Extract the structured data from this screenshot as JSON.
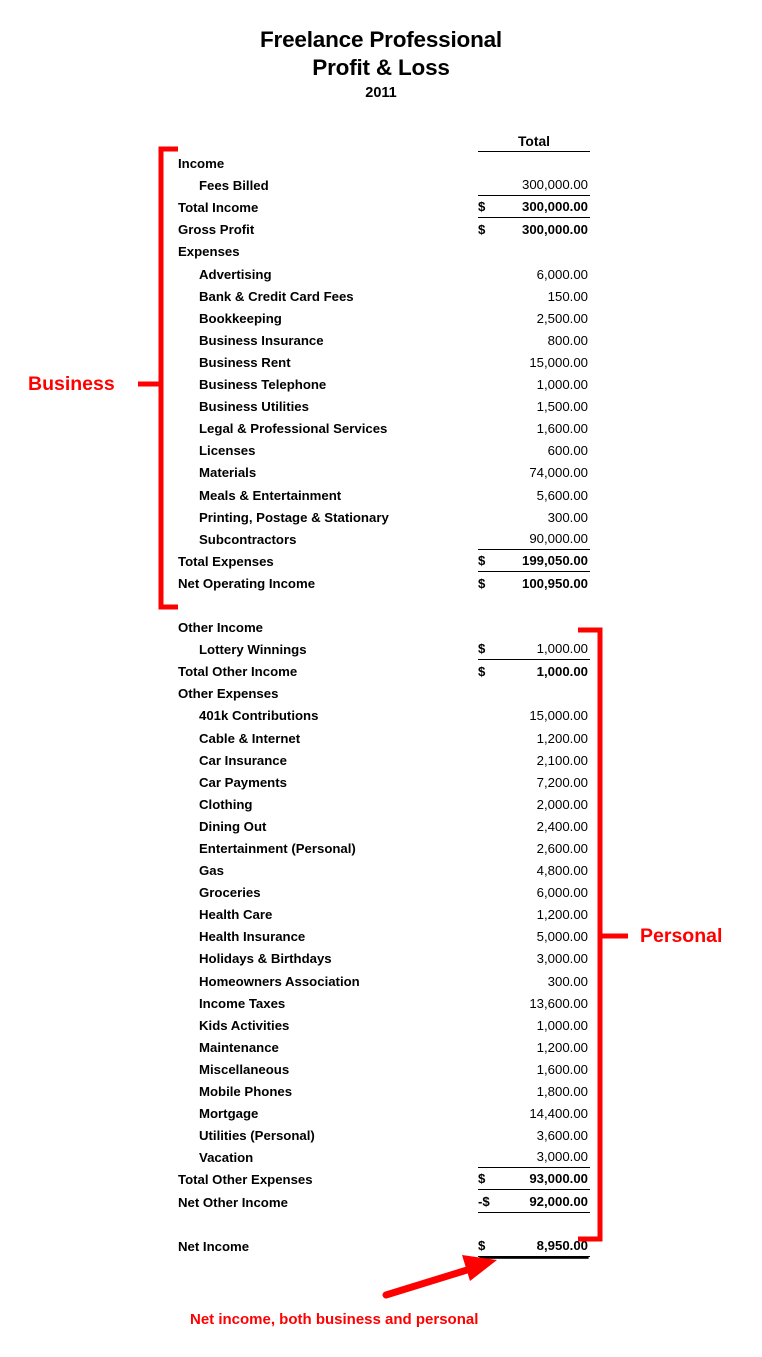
{
  "document": {
    "title_line1": "Freelance Professional",
    "title_line2": "Profit & Loss",
    "year": "2011"
  },
  "table": {
    "column_header": "Total",
    "currency_symbol": "$",
    "negative_currency_symbol": "-$"
  },
  "annotations": {
    "business_label": "Business",
    "personal_label": "Personal",
    "net_income_note": "Net income, both business and personal",
    "color": "#ff0000"
  },
  "rows": {
    "income_heading": "Income",
    "fees_billed": {
      "label": "Fees Billed",
      "amount": "300,000.00"
    },
    "total_income": {
      "label": "Total Income",
      "currency": "$",
      "amount": "300,000.00"
    },
    "gross_profit": {
      "label": "Gross Profit",
      "currency": "$",
      "amount": "300,000.00"
    },
    "expenses_heading": "Expenses",
    "business_expenses": [
      {
        "label": "Advertising",
        "amount": "6,000.00"
      },
      {
        "label": "Bank & Credit Card Fees",
        "amount": "150.00"
      },
      {
        "label": "Bookkeeping",
        "amount": "2,500.00"
      },
      {
        "label": "Business Insurance",
        "amount": "800.00"
      },
      {
        "label": "Business Rent",
        "amount": "15,000.00"
      },
      {
        "label": "Business Telephone",
        "amount": "1,000.00"
      },
      {
        "label": "Business Utilities",
        "amount": "1,500.00"
      },
      {
        "label": "Legal & Professional Services",
        "amount": "1,600.00"
      },
      {
        "label": "Licenses",
        "amount": "600.00"
      },
      {
        "label": "Materials",
        "amount": "74,000.00"
      },
      {
        "label": "Meals & Entertainment",
        "amount": "5,600.00"
      },
      {
        "label": "Printing, Postage & Stationary",
        "amount": "300.00"
      },
      {
        "label": "Subcontractors",
        "amount": "90,000.00"
      }
    ],
    "total_expenses": {
      "label": "Total Expenses",
      "currency": "$",
      "amount": "199,050.00"
    },
    "net_operating_income": {
      "label": "Net Operating Income",
      "currency": "$",
      "amount": "100,950.00"
    },
    "other_income_heading": "Other Income",
    "lottery_winnings": {
      "label": "Lottery Winnings",
      "currency": "$",
      "amount": "1,000.00"
    },
    "total_other_income": {
      "label": "Total Other Income",
      "currency": "$",
      "amount": "1,000.00"
    },
    "other_expenses_heading": "Other Expenses",
    "other_expenses": [
      {
        "label": "401k Contributions",
        "amount": "15,000.00"
      },
      {
        "label": "Cable & Internet",
        "amount": "1,200.00"
      },
      {
        "label": "Car Insurance",
        "amount": "2,100.00"
      },
      {
        "label": "Car Payments",
        "amount": "7,200.00"
      },
      {
        "label": "Clothing",
        "amount": "2,000.00"
      },
      {
        "label": "Dining Out",
        "amount": "2,400.00"
      },
      {
        "label": "Entertainment (Personal)",
        "amount": "2,600.00"
      },
      {
        "label": "Gas",
        "amount": "4,800.00"
      },
      {
        "label": "Groceries",
        "amount": "6,000.00"
      },
      {
        "label": "Health Care",
        "amount": "1,200.00"
      },
      {
        "label": "Health Insurance",
        "amount": "5,000.00"
      },
      {
        "label": "Holidays & Birthdays",
        "amount": "3,000.00"
      },
      {
        "label": "Homeowners Association",
        "amount": "300.00"
      },
      {
        "label": "Income Taxes",
        "amount": "13,600.00"
      },
      {
        "label": "Kids Activities",
        "amount": "1,000.00"
      },
      {
        "label": "Maintenance",
        "amount": "1,200.00"
      },
      {
        "label": "Miscellaneous",
        "amount": "1,600.00"
      },
      {
        "label": "Mobile Phones",
        "amount": "1,800.00"
      },
      {
        "label": "Mortgage",
        "amount": "14,400.00"
      },
      {
        "label": "Utilities (Personal)",
        "amount": "3,600.00"
      },
      {
        "label": "Vacation",
        "amount": "3,000.00"
      }
    ],
    "total_other_expenses": {
      "label": "Total Other Expenses",
      "currency": "$",
      "amount": "93,000.00"
    },
    "net_other_income": {
      "label": "Net Other Income",
      "currency": "-$",
      "amount": "92,000.00"
    },
    "net_income": {
      "label": "Net Income",
      "currency": "$",
      "amount": "8,950.00"
    }
  }
}
